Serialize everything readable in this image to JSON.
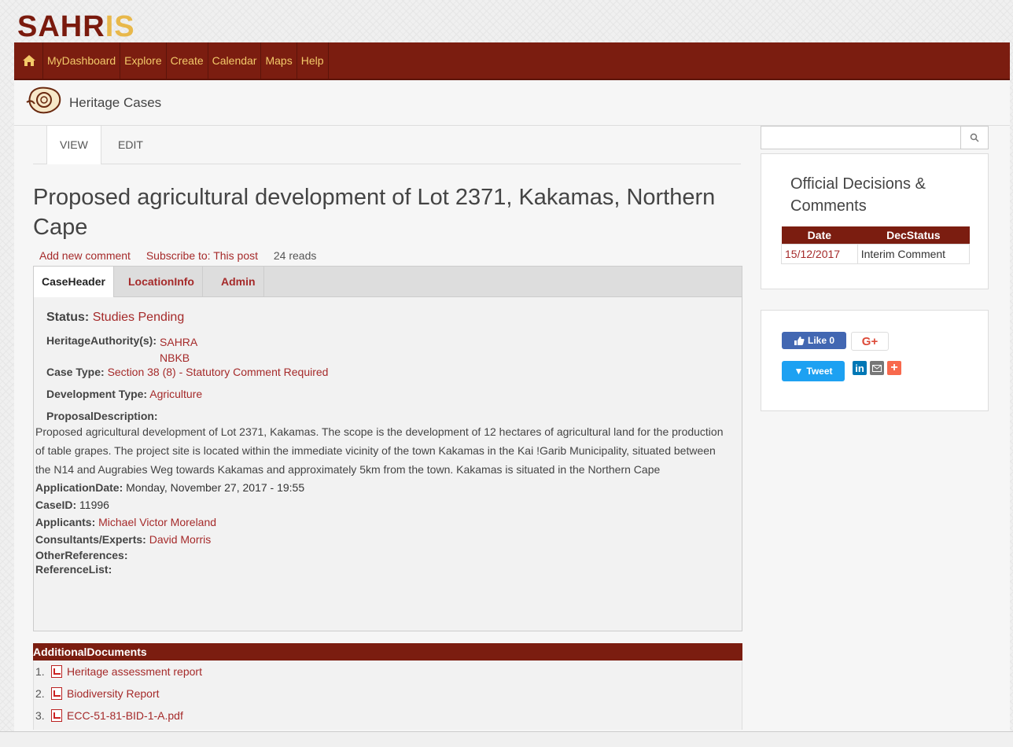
{
  "logo": {
    "part1": "SAHR",
    "part2": "IS"
  },
  "nav": [
    "MyDashboard",
    "Explore",
    "Create",
    "Calendar",
    "Maps",
    "Help"
  ],
  "breadcrumb": "Heritage Cases",
  "view_tabs": [
    "VIEW",
    "EDIT"
  ],
  "title": "Proposed agricultural development of Lot 2371, Kakamas, Northern Cape",
  "meta": {
    "add_comment": "Add new comment",
    "subscribe": "Subscribe to: This post",
    "reads": "24 reads"
  },
  "case_tabs": [
    "CaseHeader",
    "LocationInfo",
    "Admin"
  ],
  "case": {
    "status_label": "Status:",
    "status": "Studies Pending",
    "authority_label": "HeritageAuthority(s):",
    "authority1": "SAHRA",
    "authority2": "NBKB",
    "type_label": "Case Type:",
    "type": "Section 38 (8) - Statutory Comment Required",
    "devtype_label": "Development Type:",
    "devtype": "Agriculture",
    "desc_label": "ProposalDescription:",
    "description": "Proposed agricultural development of Lot 2371, Kakamas. The scope is the development of 12 hectares of agricultural land for the production of table grapes. The project site is located within the immediate vicinity of the town Kakamas in the Kai !Garib Municipality, situated between the N14 and Augrabies Weg towards Kakamas and approximately 5km from the town. Kakamas is situated in the Northern Cape",
    "appdate_label": "ApplicationDate:",
    "appdate": "Monday, November 27, 2017 - 19:55",
    "caseid_label": "CaseID:",
    "caseid": "11996",
    "applicants_label": "Applicants:",
    "applicants": "Michael Victor Moreland",
    "consultants_label": "Consultants/Experts:",
    "consultants": "David Morris",
    "otherrefs_label": "OtherReferences:",
    "reflist_label": "ReferenceList:"
  },
  "additional": {
    "header": "AdditionalDocuments",
    "items": [
      {
        "num": "1.",
        "name": "Heritage assessment report"
      },
      {
        "num": "2.",
        "name": "Biodiversity Report"
      },
      {
        "num": "3.",
        "name": "ECC-51-81-BID-1-A.pdf"
      }
    ]
  },
  "search": {
    "placeholder": ""
  },
  "decisions": {
    "title": "Official Decisions & Comments",
    "col_date": "Date",
    "col_status": "DecStatus",
    "rows": [
      {
        "date": "15/12/2017",
        "status": "Interim Comment"
      }
    ]
  },
  "social": {
    "like": "Like 0",
    "gplus": "G+",
    "tweet": "Tweet",
    "linkedin": "in",
    "plus": "+"
  },
  "colors": {
    "brand": "#7b1d10",
    "nav_text": "#f3c969",
    "link": "#a52a2a",
    "logo_accent": "#e8b84a"
  }
}
